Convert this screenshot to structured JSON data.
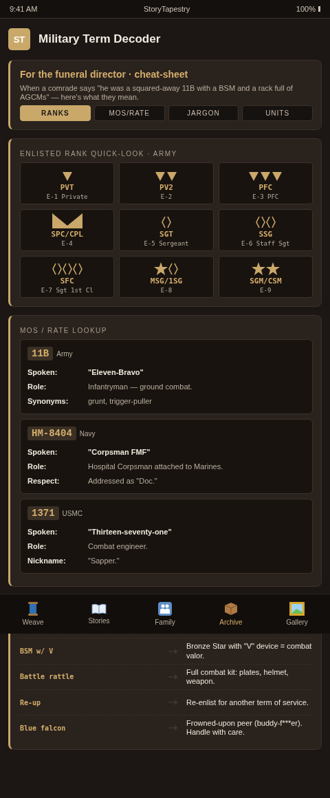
{
  "status_bar": {
    "time": "9:41 AM",
    "app": "StoryTapestry",
    "battery": "100%"
  },
  "header": {
    "logo": "ST",
    "title": "Military Term Decoder"
  },
  "intro": {
    "title": "For the funeral director · cheat-sheet",
    "text": "When a comrade says \"he was a squared-away 11B with a BSM and a rack full of AGCMs\" — here's what they mean.",
    "tabs": [
      {
        "label": "RANKS",
        "selected": true
      },
      {
        "label": "MOS/RATE",
        "selected": false
      },
      {
        "label": "JARGON",
        "selected": false
      },
      {
        "label": "UNITS",
        "selected": false
      }
    ]
  },
  "ranks": {
    "heading": "ENLISTED RANK QUICK-LOOK · ARMY",
    "items": [
      {
        "abbr": "PVT",
        "grade": "E-1 Private",
        "insignia": [
          {
            "kind": "chevron"
          }
        ]
      },
      {
        "abbr": "PV2",
        "grade": "E-2",
        "insignia": [
          {
            "kind": "chevron"
          },
          {
            "kind": "chevron"
          }
        ]
      },
      {
        "abbr": "PFC",
        "grade": "E-3 PFC",
        "insignia": [
          {
            "kind": "chevron"
          },
          {
            "kind": "chevron"
          },
          {
            "kind": "chevron"
          }
        ]
      },
      {
        "abbr": "SPC/CPL",
        "grade": "E-4",
        "insignia": [
          {
            "kind": "specialist"
          }
        ]
      },
      {
        "abbr": "SGT",
        "grade": "E-5 Sergeant",
        "insignia": [
          {
            "kind": "diamond"
          }
        ]
      },
      {
        "abbr": "SSG",
        "grade": "E-6 Staff Sgt",
        "insignia": [
          {
            "kind": "diamond"
          },
          {
            "kind": "diamond"
          }
        ]
      },
      {
        "abbr": "SFC",
        "grade": "E-7 Sgt 1st Cl",
        "insignia": [
          {
            "kind": "diamond"
          },
          {
            "kind": "diamond"
          },
          {
            "kind": "diamond"
          }
        ]
      },
      {
        "abbr": "MSG/1SG",
        "grade": "E-8",
        "insignia": [
          {
            "kind": "star"
          },
          {
            "kind": "diamond"
          }
        ]
      },
      {
        "abbr": "SGM/CSM",
        "grade": "E-9",
        "insignia": [
          {
            "kind": "star"
          },
          {
            "kind": "star"
          }
        ]
      }
    ]
  },
  "mos": {
    "heading": "MOS / RATE LOOKUP",
    "entries": [
      {
        "code": "11B",
        "branch": "Army",
        "fields": [
          {
            "label": "Spoken:",
            "value": "\"Eleven-Bravo\"",
            "kind": "spoken"
          },
          {
            "label": "Role:",
            "value": "Infantryman — ground combat.",
            "kind": "plain"
          },
          {
            "label": "Synonyms:",
            "value": "grunt, trigger-puller",
            "kind": "plain"
          }
        ]
      },
      {
        "code": "HM-8404",
        "branch": "Navy",
        "fields": [
          {
            "label": "Spoken:",
            "value": "\"Corpsman FMF\"",
            "kind": "spoken"
          },
          {
            "label": "Role:",
            "value": "Hospital Corpsman attached to Marines.",
            "kind": "plain"
          },
          {
            "label": "Respect:",
            "value": "Addressed as \"Doc.\"",
            "kind": "plain"
          }
        ]
      },
      {
        "code": "1371",
        "branch": "USMC",
        "fields": [
          {
            "label": "Spoken:",
            "value": "\"Thirteen-seventy-one\"",
            "kind": "spoken"
          },
          {
            "label": "Role:",
            "value": "Combat engineer.",
            "kind": "plain"
          },
          {
            "label": "Nickname:",
            "value": "\"Sapper.\"",
            "kind": "plain"
          }
        ]
      }
    ]
  },
  "nav": [
    {
      "kind": "spool",
      "label": "Weave",
      "selected": false
    },
    {
      "kind": "book",
      "label": "Stories",
      "selected": false
    },
    {
      "kind": "family",
      "label": "Family",
      "selected": false
    },
    {
      "kind": "box",
      "label": "Archive",
      "selected": true
    },
    {
      "kind": "frame",
      "label": "Gallery",
      "selected": false
    }
  ],
  "jargon": [
    {
      "term": "BSM w/ V",
      "meaning": "Bronze Star with \"V\" device = combat valor."
    },
    {
      "term": "Battle rattle",
      "meaning": "Full combat kit: plates, helmet, weapon."
    },
    {
      "term": "Re-up",
      "meaning": "Re-enlist for another term of service."
    },
    {
      "term": "Blue falcon",
      "meaning": "Frowned-upon peer (buddy-f***er). Handle with care."
    }
  ]
}
